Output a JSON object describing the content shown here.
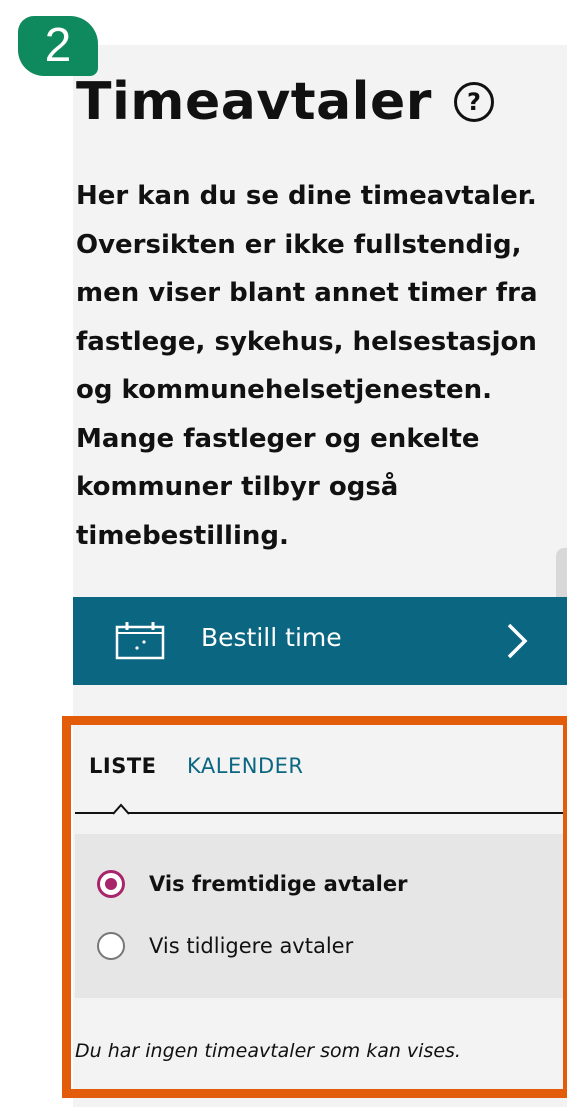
{
  "step_badge": "2",
  "page_title": "Timeavtaler",
  "help_symbol": "?",
  "intro_text": "Her kan du se dine timeavtaler. Oversikten er ikke fullstendig, men viser blant annet timer fra fastlege, sykehus, helsestasjon og kommunehelsetjenesten. Mange fastleger og enkelte kommuner tilbyr også timebestilling.",
  "book_button": {
    "label": "Bestill time",
    "icon": "calendar-icon"
  },
  "tabs": [
    {
      "label": "LISTE",
      "selected": true
    },
    {
      "label": "KALENDER",
      "selected": false
    }
  ],
  "filter": {
    "options": [
      {
        "label": "Vis fremtidige avtaler",
        "checked": true
      },
      {
        "label": "Vis tidligere avtaler",
        "checked": false
      }
    ]
  },
  "empty_message": "Du har ingen timeavtaler som kan vises.",
  "colors": {
    "brand_teal": "#0b6681",
    "badge_green": "#0f8a5f",
    "highlight_orange": "#e35c0a",
    "radio_accent": "#a8246b"
  }
}
